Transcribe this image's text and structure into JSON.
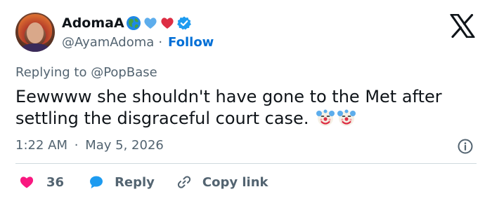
{
  "author": {
    "display_name": "AdomaA",
    "name_emojis": [
      "globe-emoji",
      "blue-heart-emoji",
      "red-heart-emoji"
    ],
    "verified_badge": "verified-badge-icon",
    "handle": "@AyamAdoma",
    "separator": "·",
    "follow_label": "Follow"
  },
  "brand": {
    "logo": "x-logo-icon"
  },
  "reply_context": {
    "prefix": "Replying to ",
    "mention": "@PopBase"
  },
  "tweet": {
    "text": "Eewwww she shouldn't have gone to the Met after settling the disgraceful court case.",
    "emojis": [
      "clown-face-emoji",
      "clown-face-emoji"
    ]
  },
  "meta": {
    "time": "1:22 AM",
    "separator": "·",
    "date": "May 5, 2026"
  },
  "actions": {
    "like_count": "36",
    "reply_label": "Reply",
    "copy_link_label": "Copy link"
  },
  "colors": {
    "text_primary": "#0f1419",
    "text_secondary": "#536471",
    "link_blue": "#006fd6",
    "like_red": "#f91880",
    "reply_blue": "#1d9bf0",
    "divider": "#cfd9de"
  }
}
